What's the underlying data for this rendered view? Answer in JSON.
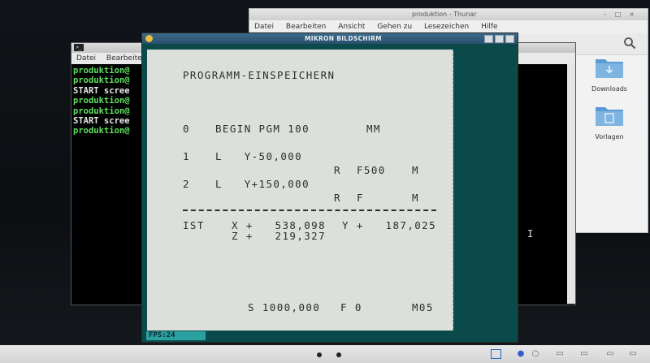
{
  "thunar": {
    "title": "produktion - Thunar",
    "menu": [
      "Datei",
      "Bearbeiten",
      "Ansicht",
      "Gehen zu",
      "Lesezeichen",
      "Hilfe"
    ],
    "files": [
      {
        "label": "Downloads",
        "icon": "folder-download-icon"
      },
      {
        "label": "Vorlagen",
        "icon": "folder-templates-icon"
      }
    ]
  },
  "terminal": {
    "menu": [
      "Datei",
      "Bearbeiten"
    ],
    "lines": [
      {
        "text": "produktion@",
        "color": "#5fe05f"
      },
      {
        "text": "produktion@",
        "color": "#5fe05f"
      },
      {
        "text": "START scree",
        "color": "#e8e8e8"
      },
      {
        "text": "produktion@",
        "color": "#5fe05f"
      },
      {
        "text": "produktion@",
        "color": "#5fe05f"
      },
      {
        "text": "START scree",
        "color": "#e8e8e8"
      },
      {
        "text": "produktion@",
        "color": "#5fe05f"
      }
    ]
  },
  "mikron": {
    "title": "MIKRON BILDSCHIRM",
    "heading": "PROGRAMM-EINSPEICHERN",
    "row0_num": "0",
    "row0_text": "BEGIN PGM 100",
    "row0_unit": "MM",
    "row1_num": "1",
    "row1_text": "L   Y-50,000",
    "row1_r": "R",
    "row1_f": "F500",
    "row1_m": "M",
    "row2_num": "2",
    "row2_text": "L   Y+150,000",
    "row2_r": "R",
    "row2_f": "F",
    "row2_m": "M",
    "ist_label": "IST",
    "ist_x": "X +   538,098",
    "ist_y": "Y +   187,025",
    "ist_z": "Z +   219,327",
    "status_s": "S 1000,000",
    "status_f": "F 0",
    "status_m": "M05",
    "fps": "FPS:24"
  }
}
